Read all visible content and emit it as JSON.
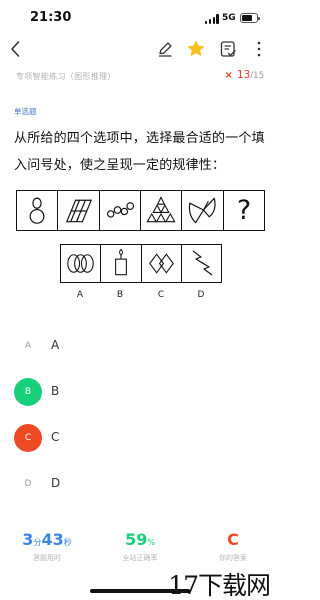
{
  "status": {
    "time": "21:30",
    "network": "5G"
  },
  "nav": {
    "icons": [
      "back-icon",
      "edit-icon",
      "star-icon",
      "answer-card-icon",
      "share-icon"
    ],
    "star_color": "#f7c21b"
  },
  "header": {
    "category": "专项智能练习（图形推理）",
    "progress_current": "13",
    "progress_separator": "/",
    "progress_total": "15",
    "close_mark": "×"
  },
  "question": {
    "type": "单选题",
    "line1": "从所给的四个选项中，选择最合适的一个填",
    "line2": "入问号处，使之呈现一定的规律性：",
    "stem_figures": [
      "figure-8-shape",
      "parallelogram-lines-shape",
      "chain-circles-shape",
      "triangles-shape",
      "fan-shape",
      "question-mark"
    ],
    "unknown_mark": "?",
    "options": [
      {
        "letter": "A",
        "figure": "overlapping-ovals-shape"
      },
      {
        "letter": "B",
        "figure": "candle-shape"
      },
      {
        "letter": "C",
        "figure": "diamonds-shape"
      },
      {
        "letter": "D",
        "figure": "lightning-shape"
      }
    ]
  },
  "choices": [
    {
      "letter": "A",
      "label": "A",
      "state": "unselected"
    },
    {
      "letter": "B",
      "label": "B",
      "state": "correct",
      "color": "#19d07a"
    },
    {
      "letter": "C",
      "label": "C",
      "state": "selected-wrong",
      "color": "#ee4a26"
    },
    {
      "letter": "D",
      "label": "D",
      "state": "unselected"
    }
  ],
  "stats": [
    {
      "value_parts": [
        "3",
        "分",
        "43",
        "秒"
      ],
      "label": "答题用时",
      "color": "#3f86e0"
    },
    {
      "value_parts": [
        "59",
        "%"
      ],
      "label": "全站正确率",
      "color": "#19d07a"
    },
    {
      "value_parts": [
        "C"
      ],
      "label": "你的答案",
      "color": "#ee4a26"
    }
  ],
  "watermark": "17下载网"
}
